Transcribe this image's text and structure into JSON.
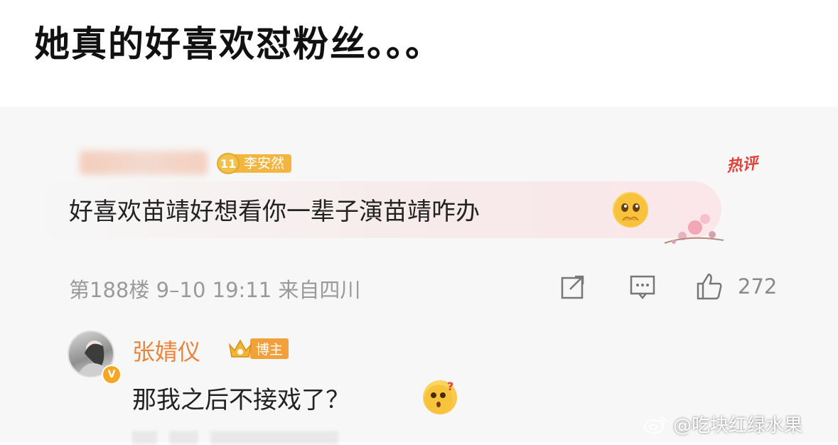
{
  "caption": "她真的好喜欢怼粉丝。。。",
  "comment": {
    "fan_level": "11",
    "fan_badge": "李安然",
    "hot_tag": "热评",
    "text": "好喜欢苗靖好想看你一辈子演苗靖咋办",
    "meta": "第188楼 9–10 19:11 来自四川",
    "like_count": "272",
    "icons": [
      "share-icon",
      "comment-icon",
      "like-icon"
    ]
  },
  "reply": {
    "name": "张婧仪",
    "host_tag": "博主",
    "verify_mark": "V",
    "text": "那我之后不接戏了？"
  },
  "watermark": "@吃块红绿水果",
  "colors": {
    "accent_orange": "#e9853b",
    "hot_red": "#e0413a",
    "meta_gray": "#9a9a9a",
    "badge_gold": "#f3b53d"
  }
}
